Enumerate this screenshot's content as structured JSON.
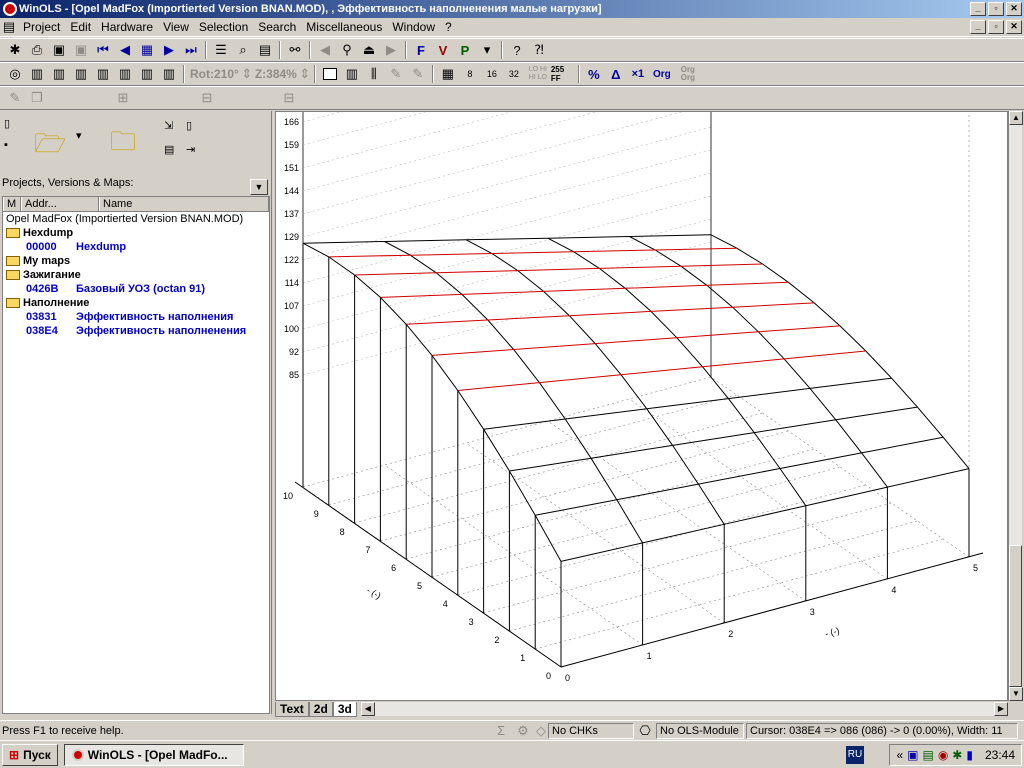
{
  "window": {
    "title": "WinOLS - [Opel MadFox (Importierted Version BNAN.MOD), , Эффективность наполненения малые нагрузки]"
  },
  "menu": [
    "Project",
    "Edit",
    "Hardware",
    "View",
    "Selection",
    "Search",
    "Miscellaneous",
    "Window",
    "?"
  ],
  "toolbar2": {
    "rotation": "Rot:210°",
    "zoom": "Z:384%",
    "buttons": [
      "8",
      "16",
      "32",
      "LO HI HI LO",
      "255 FF",
      "%",
      "Δ",
      "×1",
      "Org",
      "Org Org"
    ]
  },
  "projects_label": "Projects, Versions & Maps:",
  "tree": {
    "columns": [
      "M",
      "Addr...",
      "Name"
    ],
    "project": "Opel MadFox (Importierted Version BNAN.MOD)",
    "folders": [
      {
        "name": "Hexdump",
        "maps": [
          {
            "addr": "00000",
            "name": "Hexdump"
          }
        ]
      },
      {
        "name": "My maps",
        "maps": []
      },
      {
        "name": "Зажигание",
        "maps": [
          {
            "addr": "0426B",
            "name": "Базовый УОЗ (octan 91)"
          }
        ]
      },
      {
        "name": "Наполнение",
        "maps": [
          {
            "addr": "03831",
            "name": "Эффективность наполнения"
          },
          {
            "addr": "038E4",
            "name": "Эффективность наполненения"
          }
        ]
      }
    ]
  },
  "chart_data": {
    "type": "3d-surface",
    "z_ticks": [
      "166",
      "159",
      "151",
      "144",
      "137",
      "129",
      "122",
      "114",
      "107",
      "100",
      "92",
      "85"
    ],
    "axis_left_ticks": [
      "0",
      "1",
      "2",
      "3",
      "4",
      "5",
      "6",
      "7",
      "8",
      "9",
      "10"
    ],
    "axis_right_ticks": [
      "0",
      "1",
      "2",
      "3",
      "4",
      "5"
    ],
    "axis_left_label": "- (-)",
    "axis_right_label": "- (-)"
  },
  "view_tabs": [
    "Text",
    "2d",
    "3d"
  ],
  "statusbar": {
    "help": "Press F1 to receive help.",
    "chk": "No CHKs",
    "module": "No OLS-Module",
    "cursor": "Cursor: 038E4 => 086 (086) -> 0 (0.00%), Width: 11"
  },
  "taskbar": {
    "start": "Пуск",
    "task": "WinOLS - [Opel MadFo...",
    "lang": "RU",
    "time": "23:44"
  }
}
